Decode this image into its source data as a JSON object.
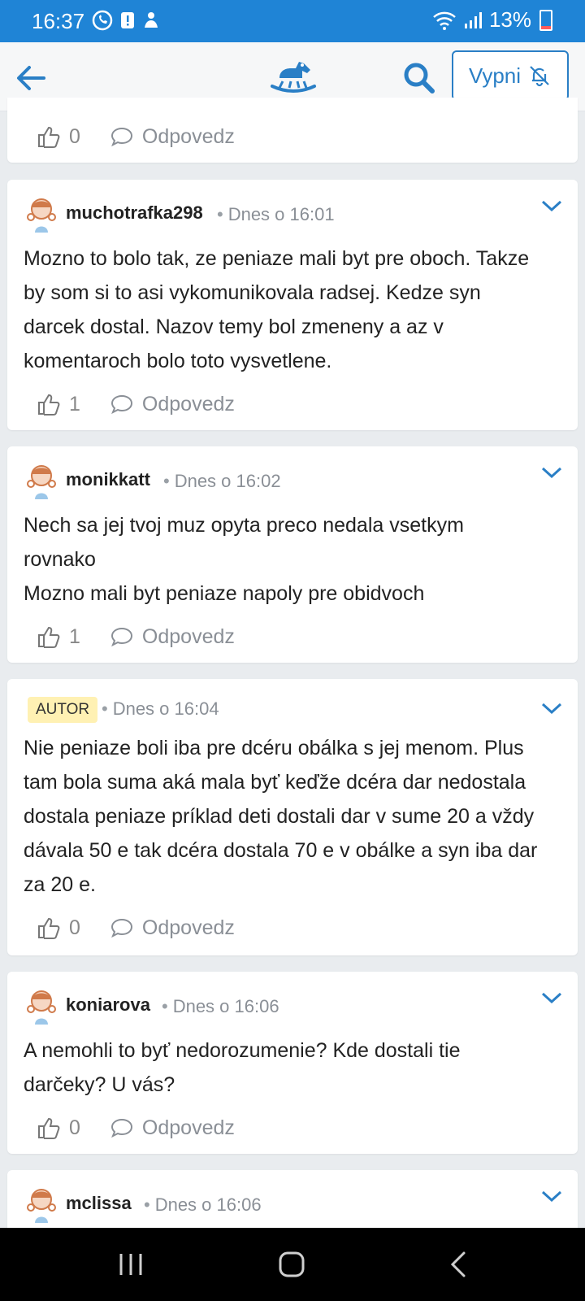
{
  "status_bar": {
    "time": "16:37",
    "battery": "13%"
  },
  "top_bar": {
    "mute_label": "Vypni"
  },
  "colors": {
    "status_bar_bg": "#1f84d6",
    "accent": "#2a7fc6",
    "author_badge_bg": "#fff1b3"
  },
  "partial_card": {
    "likes": "0",
    "reply_label": "Odpovedz"
  },
  "comments": [
    {
      "username": "muchotrafka298",
      "time": "Dnes o 16:01",
      "lines": [
        "Mozno to bolo tak, ze peniaze mali byt pre oboch. Takze",
        "by som si to asi vykomunikovala radsej. Kedze syn",
        "darcek dostal. Nazov temy bol zmeneny a az v",
        "komentaroch bolo toto vysvetlene."
      ],
      "likes": "1",
      "reply_label": "Odpovedz"
    },
    {
      "username": "monikkatt",
      "time": "Dnes o 16:02",
      "lines": [
        "Nech sa jej tvoj muz opyta preco nedala vsetkym",
        "rovnako",
        "Mozno mali byt peniaze napoly pre obidvoch"
      ],
      "likes": "1",
      "reply_label": "Odpovedz"
    },
    {
      "badge": "AUTOR",
      "time": "Dnes o 16:04",
      "lines": [
        "Nie peniaze boli iba pre dcéru obálka s jej menom. Plus",
        "tam bola suma aká mala byť keďže dcéra dar nedostala",
        "dostala peniaze príklad deti dostali dar v sume 20 a vždy",
        "dávala 50 e tak dcéra dostala 70 e v obálke a syn iba dar",
        "za 20 e."
      ],
      "likes": "0",
      "reply_label": "Odpovedz"
    },
    {
      "username": "koniarova",
      "time": "Dnes o 16:06",
      "lines": [
        "A nemohli to byť nedorozumenie? Kde dostali tie",
        "darčeky? U vás?"
      ],
      "likes": "0",
      "reply_label": "Odpovedz"
    },
    {
      "username": "mclissa",
      "time": "Dnes o 16:06"
    }
  ]
}
